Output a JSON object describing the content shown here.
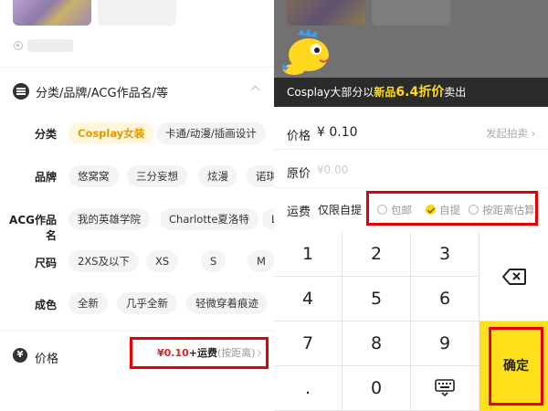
{
  "left": {
    "filter_title": "分类/品牌/ACG作品名/等",
    "rows": [
      {
        "label": "分类",
        "chips": [
          {
            "text": "Cosplay女装",
            "active": true
          },
          {
            "text": "卡通/动漫/插画设计"
          }
        ]
      },
      {
        "label": "品牌",
        "chips": [
          {
            "text": "悠窝窝"
          },
          {
            "text": "三分妄想"
          },
          {
            "text": "炫漫"
          },
          {
            "text": "诺琪"
          }
        ]
      },
      {
        "label": "ACG作品名",
        "chips": [
          {
            "text": "我的英雄学院"
          },
          {
            "text": "Charlotte夏洛特"
          },
          {
            "text": "L"
          }
        ]
      },
      {
        "label": "尺码",
        "chips": [
          {
            "text": "2XS及以下"
          },
          {
            "text": "XS"
          },
          {
            "text": "S"
          },
          {
            "text": "M"
          }
        ]
      },
      {
        "label": "成色",
        "chips": [
          {
            "text": "全新"
          },
          {
            "text": "几乎全新"
          },
          {
            "text": "轻微穿着痕迹"
          }
        ]
      }
    ],
    "price": {
      "label": "价格",
      "icon": "¥",
      "value": "¥0.10",
      "shipping": "+运费",
      "shipping_note": "(按距离)"
    }
  },
  "right": {
    "promo": {
      "prefix": "Cosplay大部分以",
      "highlight_1": "新品",
      "highlight_2": "6.4折价",
      "suffix": "卖出"
    },
    "price_label": "价格",
    "price_value": "¥ 0.10",
    "auction_link": "发起拍卖 ›",
    "original_label": "原价",
    "original_placeholder": "¥0.00",
    "shipping_label": "运费",
    "shipping_pickup_only": "仅限自提",
    "shipping_options": [
      {
        "label": "包邮",
        "selected": false
      },
      {
        "label": "自提",
        "selected": true
      },
      {
        "label": "按距离估算",
        "selected": false
      }
    ],
    "keypad": {
      "keys": [
        "1",
        "2",
        "3",
        "4",
        "5",
        "6",
        "7",
        "8",
        "9",
        ".",
        "0"
      ],
      "confirm": "确定"
    }
  },
  "colors": {
    "accent_yellow": "#ffe01a",
    "highlight_red": "#e80000",
    "price_red": "#e02020",
    "chip_active": "#e39a00"
  }
}
